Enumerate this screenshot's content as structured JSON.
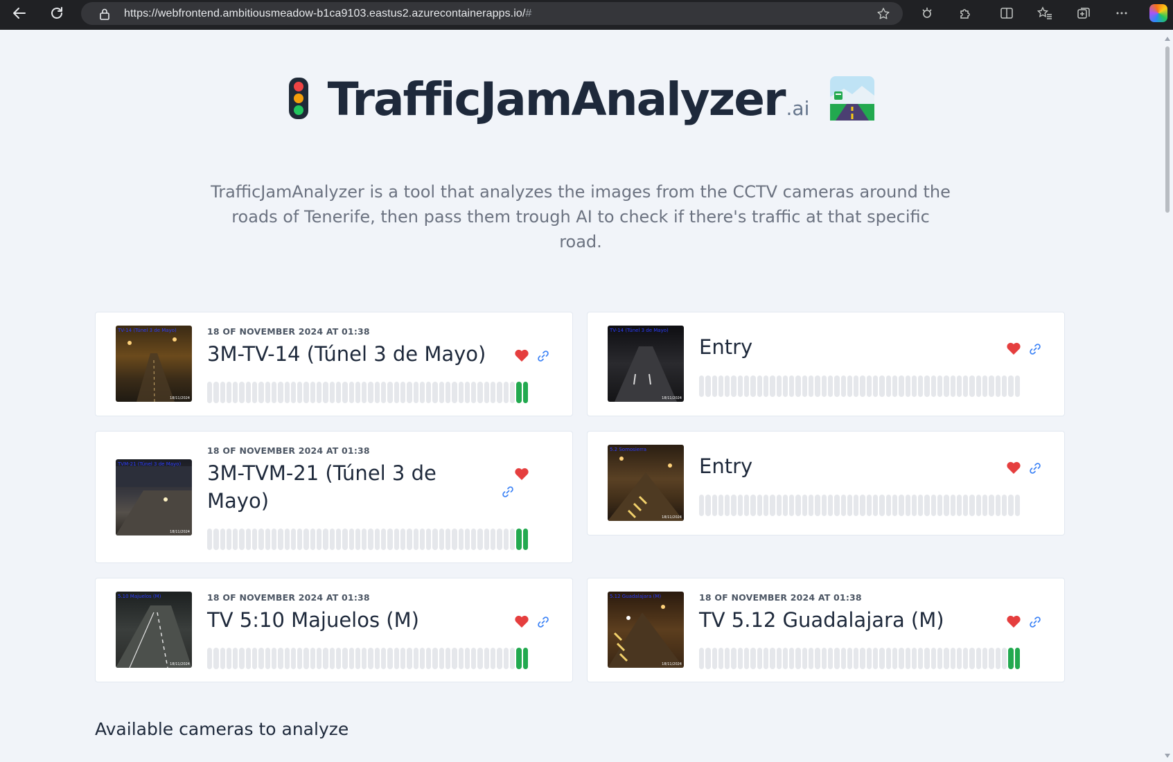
{
  "browser": {
    "url_main": "https://webfrontend.ambitiousmeadow-b1ca9103.eastus2.azurecontainerapps.io/",
    "url_hash": "#",
    "icons": [
      "back-icon",
      "refresh-icon",
      "lock-icon",
      "favorite-star-icon",
      "tracking-icon",
      "extensions-icon",
      "split-screen-icon",
      "favorites-icon",
      "collections-icon",
      "more-icon",
      "copilot-icon"
    ]
  },
  "header": {
    "title": "TrafficJamAnalyzer",
    "title_suffix": ".ai",
    "left_icon": "traffic-light-icon",
    "right_icon": "motorway-icon"
  },
  "intro": "TrafficJamAnalyzer is a tool that analyzes the images from the CCTV cameras around the roads of Tenerife, then pass them trough AI to check if there's traffic at that specific road.",
  "cards": [
    {
      "date": "18 OF NOVEMBER 2024 AT 01:38",
      "title": "3M-TV-14 (Túnel 3 de Mayo)",
      "cam_label": "TV-14 (Túnel 3 de Mayo)",
      "cam_date": "18/11/2024",
      "traffic_level": 0.04
    },
    {
      "date": "",
      "title": "Entry",
      "cam_label": "TV-14 (Túnel 3 de Mayo)",
      "cam_date": "18/11/2024",
      "traffic_level": 0
    },
    {
      "date": "18 OF NOVEMBER 2024 AT 01:38",
      "title": "3M-TVM-21 (Túnel 3 de Mayo)",
      "cam_label": "TVM-21 (Túnel 3 de Mayo)",
      "cam_date": "18/11/2024",
      "traffic_level": 0.04
    },
    {
      "date": "",
      "title": "Entry",
      "cam_label": "5.2 Somosierra",
      "cam_date": "18/11/2024",
      "traffic_level": 0
    },
    {
      "date": "18 OF NOVEMBER 2024 AT 01:38",
      "title": "TV 5:10 Majuelos (M)",
      "cam_label": "5.10 Majuelos (M)",
      "cam_date": "18/11/2024",
      "traffic_level": 0.04
    },
    {
      "date": "18 OF NOVEMBER 2024 AT 01:38",
      "title": "TV 5.12 Guadalajara (M)",
      "cam_label": "5.12 Guadalajara (M)",
      "cam_date": "18/11/2024",
      "traffic_level": 0.04
    }
  ],
  "section_title": "Available cameras to analyze",
  "colors": {
    "background": "#f1f4f9",
    "heart": "#e53e3e",
    "link": "#3b82f6",
    "traffic_bar_active": "#22a94f",
    "traffic_bar_idle": "#e5e7eb"
  }
}
